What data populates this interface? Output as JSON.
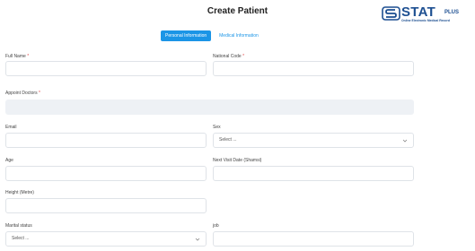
{
  "header": {
    "title": "Create Patient"
  },
  "logo": {
    "word": "STAT",
    "plus": "PLUS",
    "tagline": "Online Electronic Medical Record"
  },
  "tabs": [
    {
      "label": "Personal Information",
      "active": true
    },
    {
      "label": "Medical Information",
      "active": false
    }
  ],
  "form": {
    "full_name_label": "Full Name",
    "national_code_label": "National Code",
    "appoint_doctors_label": "Appoint Doctors",
    "email_label": "Email",
    "sex_label": "Sex",
    "sex_placeholder": "Select ...",
    "age_label": "Age",
    "next_visit_label": "Next Visit Date (Shamsi)",
    "height_label": "Height (Metre)",
    "marital_label": "Marital status",
    "marital_placeholder": "Select ...",
    "job_label": "job",
    "required_mark": "*"
  },
  "colors": {
    "accent": "#1b95e6",
    "brand": "#1d4f91",
    "required": "#e24a4a"
  }
}
